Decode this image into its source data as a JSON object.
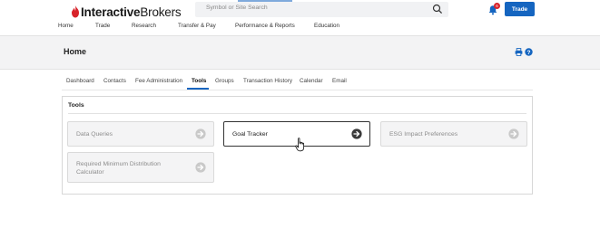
{
  "brand": {
    "name_bold": "Interactive",
    "name_light": "Brokers",
    "accent_color": "#d8232a"
  },
  "search": {
    "placeholder": "Symbol or Site Search",
    "icon": "search-icon"
  },
  "notifications": {
    "icon": "bell-icon",
    "count": "6"
  },
  "trade_button": {
    "label": "Trade",
    "color": "#1565c0"
  },
  "main_nav": [
    "Home",
    "Trade",
    "Research",
    "Transfer & Pay",
    "Performance & Reports",
    "Education"
  ],
  "page": {
    "title": "Home",
    "actions": [
      "print-icon",
      "help-icon"
    ]
  },
  "tabs": {
    "items": [
      "Dashboard",
      "Contacts",
      "Fee Administration",
      "Tools",
      "Groups",
      "Transaction History",
      "Calendar",
      "Email"
    ],
    "active": "Tools"
  },
  "tools": {
    "title": "Tools",
    "tiles": [
      {
        "label": "Data Queries",
        "state": "disabled"
      },
      {
        "label": "Goal Tracker",
        "state": "active"
      },
      {
        "label": "ESG Impact Preferences",
        "state": "disabled"
      },
      {
        "label": "Required Minimum Distribution Calculator",
        "state": "disabled"
      }
    ]
  }
}
